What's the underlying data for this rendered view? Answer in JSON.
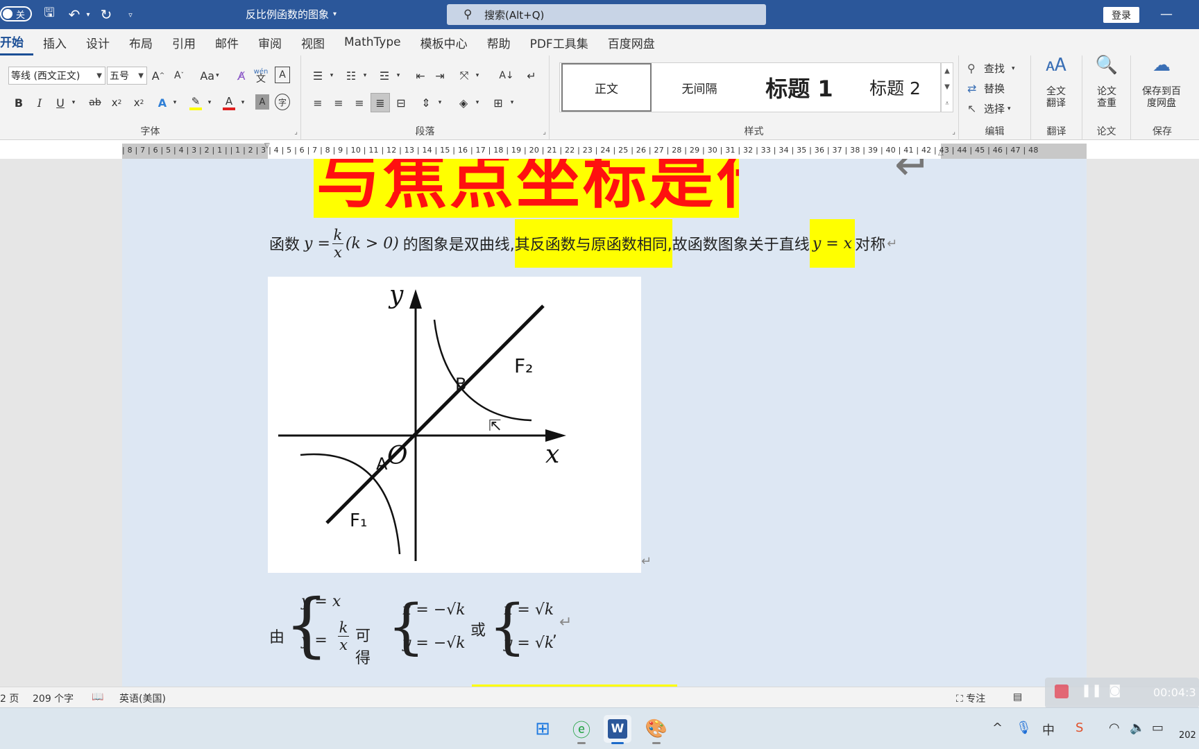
{
  "titlebar": {
    "autosave_label": "关",
    "document_title": "反比例函数的图象",
    "search_text": "搜索(Alt+Q)",
    "login_label": "登录",
    "minimize_glyph": "—"
  },
  "tabs": [
    "开始",
    "插入",
    "设计",
    "布局",
    "引用",
    "邮件",
    "审阅",
    "视图",
    "MathType",
    "模板中心",
    "帮助",
    "PDF工具集",
    "百度网盘"
  ],
  "ribbon": {
    "font_name": "等线 (西文正文)",
    "font_size": "五号",
    "group_font": "字体",
    "group_paragraph": "段落",
    "group_styles": "样式",
    "group_edit": "编辑",
    "group_translate": "翻译",
    "group_paper": "论文",
    "group_save": "保存",
    "styles": [
      "正文",
      "无间隔",
      "标题 1",
      "标题 2"
    ],
    "edit": {
      "find": "查找",
      "replace": "替换",
      "select": "选择"
    },
    "translate_btn": "全文翻译",
    "paper_btn": "论文查重",
    "save_btn": "保存到百度网盘",
    "aa_label": "Aa",
    "wen_label": "wén"
  },
  "ruler": {
    "text": "| 8 | 7 | 6 | 5 | 4 | 3 | 2 | 1 |   | 1 | 2 | 3 | 4 | 5 | 6 | 7 | 8 | 9 | 10 | 11 | 12 | 13 | 14 | 15 | 16 | 17 | 18 | 19 | 20 | 21 | 22 | 23 | 24 | 25 | 26 | 27 | 28 | 29 | 30 | 31 | 32 | 33 | 34 | 35 | 36 | 37 | 38 | 39 | 40 | 41 | 42 | 43 | 44 | 45 | 46 | 47 | 48"
  },
  "document": {
    "banner_text": "与焦点坐标是什么?",
    "para1": {
      "prefix": "函数",
      "y_eq": "y =",
      "num": "k",
      "den": "x",
      "cond": "(k > 0)",
      "middle": "的图象是双曲线,",
      "highlight": "其反函数与原函数相同,",
      "after": "故函数图象关于直线",
      "line_eq": "y = x",
      "suffix": "对称"
    },
    "figure": {
      "y_axis": "y",
      "x_axis": "x",
      "origin": "O",
      "point_a": "A",
      "point_b": "B",
      "curve_f1": "F₁",
      "curve_f2": "F₂"
    },
    "para2": {
      "you": "由",
      "sys1_line1": "y = x",
      "sys1_y": "y =",
      "sys1_num": "k",
      "sys1_den": "x",
      "kede": "可得",
      "sys2_line1": "x = −√k",
      "sys2_line2": "y = −√k",
      "huo": "或",
      "sys3_line1": "x = √k",
      "sys3_line2": "y = √k",
      "comma": ","
    },
    "para_mark": "↵"
  },
  "statusbar": {
    "page": "2 页",
    "words": "209 个字",
    "language": "英语(美国)",
    "focus": "专注",
    "recording_time": "00:04:3"
  },
  "taskbar": {
    "clock": "202"
  }
}
